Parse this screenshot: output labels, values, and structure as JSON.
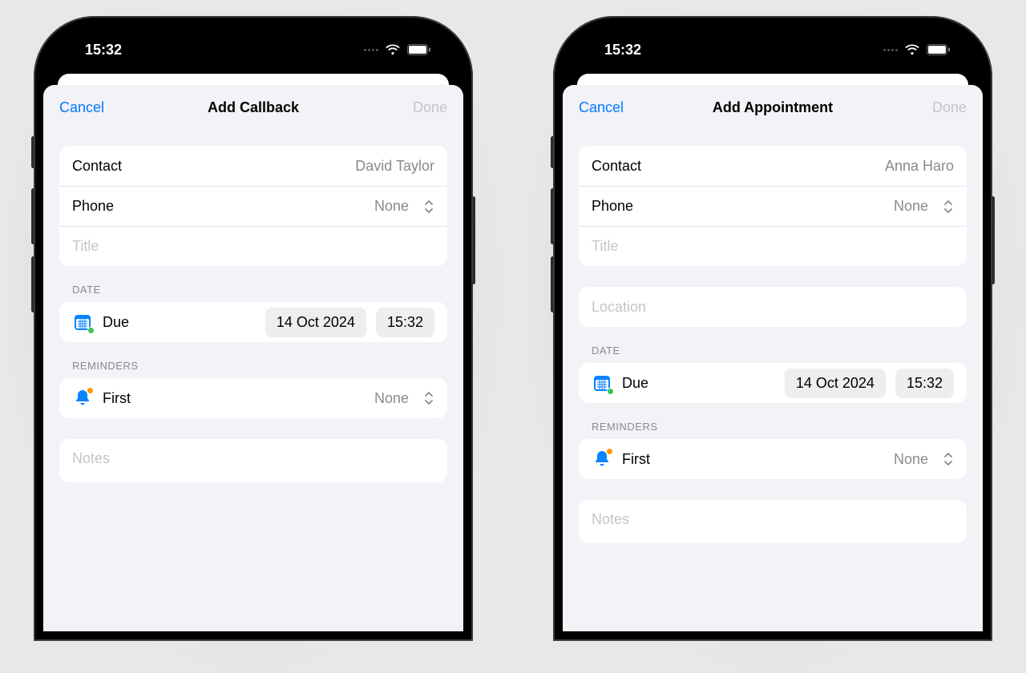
{
  "status": {
    "time": "15:32"
  },
  "phone1": {
    "header": {
      "cancel": "Cancel",
      "title": "Add Callback",
      "done": "Done"
    },
    "contact": {
      "label": "Contact",
      "value": "David Taylor"
    },
    "phone": {
      "label": "Phone",
      "value": "None"
    },
    "titleField": {
      "placeholder": "Title"
    },
    "date": {
      "section": "DATE",
      "dueLabel": "Due",
      "dueDate": "14 Oct 2024",
      "dueTime": "15:32"
    },
    "reminders": {
      "section": "REMINDERS",
      "firstLabel": "First",
      "firstValue": "None"
    },
    "notes": {
      "placeholder": "Notes"
    }
  },
  "phone2": {
    "header": {
      "cancel": "Cancel",
      "title": "Add Appointment",
      "done": "Done"
    },
    "contact": {
      "label": "Contact",
      "value": "Anna Haro"
    },
    "phone": {
      "label": "Phone",
      "value": "None"
    },
    "titleField": {
      "placeholder": "Title"
    },
    "locationField": {
      "placeholder": "Location"
    },
    "date": {
      "section": "DATE",
      "dueLabel": "Due",
      "dueDate": "14 Oct 2024",
      "dueTime": "15:32"
    },
    "reminders": {
      "section": "REMINDERS",
      "firstLabel": "First",
      "firstValue": "None"
    },
    "notes": {
      "placeholder": "Notes"
    }
  }
}
